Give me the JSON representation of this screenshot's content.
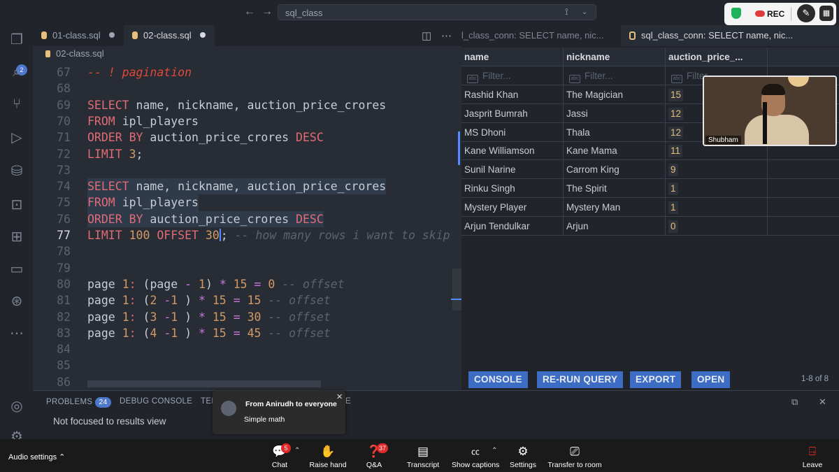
{
  "window": {
    "search_text": "sql_class",
    "rec_label": "REC"
  },
  "editor": {
    "tabs": [
      {
        "label": "01-class.sql"
      },
      {
        "label": "02-class.sql"
      }
    ],
    "breadcrumb": "02-class.sql",
    "lines": [
      {
        "n": "67",
        "text": "-- ! pagination"
      },
      {
        "n": "68",
        "text": ""
      },
      {
        "n": "69",
        "text": "SELECT name, nickname, auction_price_crores"
      },
      {
        "n": "70",
        "text": "FROM ipl_players"
      },
      {
        "n": "71",
        "text": "ORDER BY auction_price_crores DESC"
      },
      {
        "n": "72",
        "text": "LIMIT 3;"
      },
      {
        "n": "73",
        "text": ""
      },
      {
        "n": "74",
        "text": "SELECT name, nickname, auction_price_crores"
      },
      {
        "n": "75",
        "text": "FROM ipl_players"
      },
      {
        "n": "76",
        "text": "ORDER BY auction_price_crores DESC"
      },
      {
        "n": "77",
        "text": "LIMIT 100 OFFSET 30; -- how many rows i want to skip"
      },
      {
        "n": "78",
        "text": ""
      },
      {
        "n": "79",
        "text": ""
      },
      {
        "n": "80",
        "text": "page 1: (page - 1) * 15 = 0 -- offset"
      },
      {
        "n": "81",
        "text": "page 1: (2 -1 ) * 15 = 15 -- offset"
      },
      {
        "n": "82",
        "text": "page 1: (3 -1 ) * 15 = 30 -- offset"
      },
      {
        "n": "83",
        "text": "page 1: (4 -1 ) * 15 = 45 -- offset"
      },
      {
        "n": "84",
        "text": ""
      },
      {
        "n": "85",
        "text": ""
      },
      {
        "n": "86",
        "text": ""
      }
    ]
  },
  "results": {
    "tabs": [
      {
        "label": "l_class_conn: SELECT name, nic..."
      },
      {
        "label": "sql_class_conn: SELECT name, nic..."
      }
    ],
    "columns": [
      "name",
      "nickname",
      "auction_price_..."
    ],
    "filter_placeholder": "Filter...",
    "rows": [
      {
        "name": "Rashid Khan",
        "nickname": "The Magician",
        "price": "15"
      },
      {
        "name": "Jasprit Bumrah",
        "nickname": "Jassi",
        "price": "12"
      },
      {
        "name": "MS Dhoni",
        "nickname": "Thala",
        "price": "12"
      },
      {
        "name": "Kane Williamson",
        "nickname": "Kane Mama",
        "price": "11"
      },
      {
        "name": "Sunil Narine",
        "nickname": "Carrom King",
        "price": "9"
      },
      {
        "name": "Rinku Singh",
        "nickname": "The Spirit",
        "price": "1"
      },
      {
        "name": "Mystery Player",
        "nickname": "Mystery Man",
        "price": "1"
      },
      {
        "name": "Arjun Tendulkar",
        "nickname": "Arjun",
        "price": "0"
      }
    ],
    "buttons": [
      "CONSOLE",
      "RE-RUN QUERY",
      "EXPORT",
      "OPEN"
    ],
    "count": "1-8 of 8"
  },
  "video": {
    "name": "Shubham"
  },
  "panel": {
    "problems_label": "PROBLEMS",
    "problems_count": "24",
    "debug_label": "DEBUG CONSOLE",
    "terminal_label": "TER",
    "trailing_label": "E",
    "message": "Not focused to results view"
  },
  "chat_popup": {
    "from": "From Anirudh to everyone",
    "message": "Simple math"
  },
  "zoom_toolbar": {
    "audio_settings": "Audio settings",
    "items": [
      {
        "label": "Chat",
        "badge": "5"
      },
      {
        "label": "Raise hand"
      },
      {
        "label": "Q&A",
        "badge": "37"
      },
      {
        "label": "Transcript"
      },
      {
        "label": "Show captions"
      },
      {
        "label": "Settings"
      },
      {
        "label": "Transfer to room"
      },
      {
        "label": "Leave"
      }
    ]
  },
  "activity_badge": "2",
  "colors": {
    "keyword": "#e06c75",
    "number": "#d19a66",
    "comment": "#5c6370",
    "accent": "#3d6cc4",
    "leave": "#e02828"
  }
}
